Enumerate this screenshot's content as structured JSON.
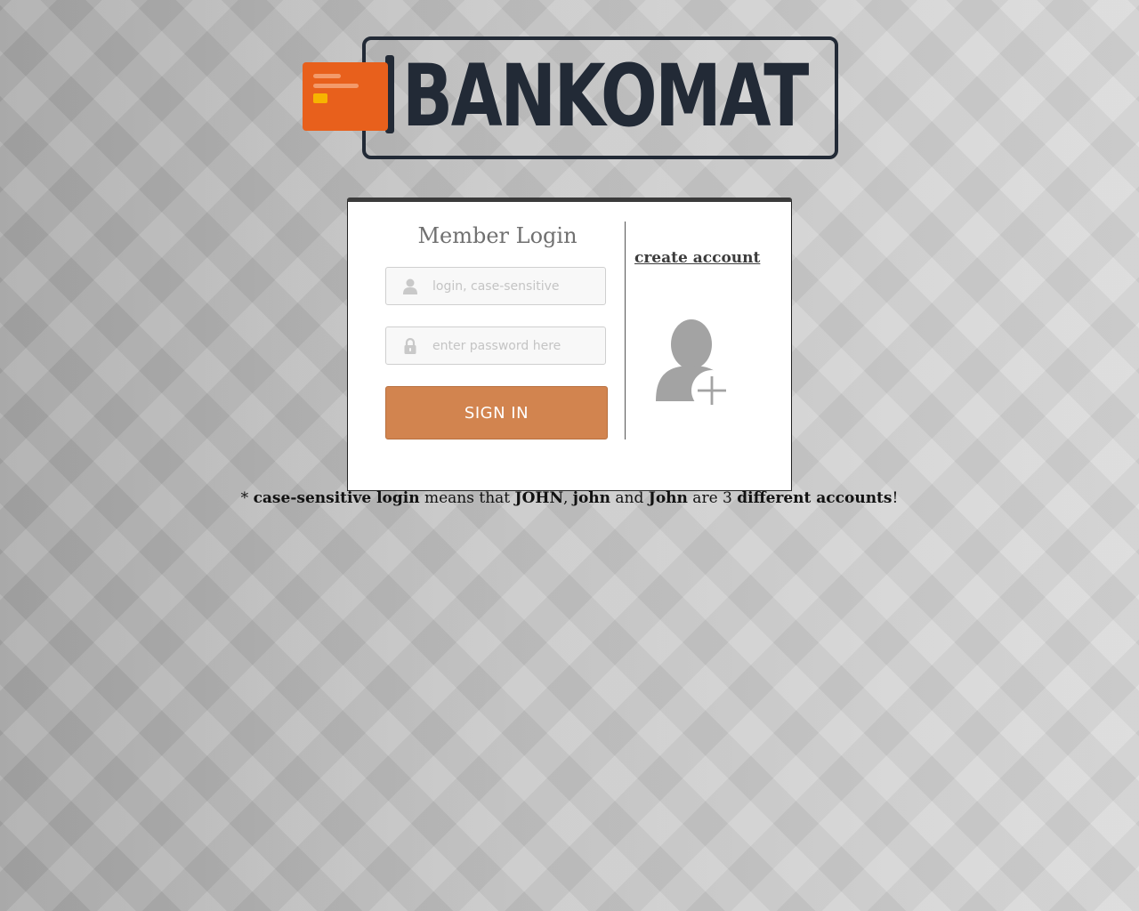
{
  "logo": {
    "text": "BANKOMAT",
    "icon": "credit-card-icon",
    "colors": {
      "card": "#e8601c",
      "chip": "#f7b400",
      "frame": "#222a36"
    }
  },
  "login": {
    "title": "Member Login",
    "username": {
      "placeholder": "login, case-sensitive",
      "value": "",
      "icon": "user-icon"
    },
    "password": {
      "placeholder": "enter password here",
      "value": "",
      "icon": "lock-icon"
    },
    "submit_label": "SIGN IN",
    "accent_color": "#d2844f"
  },
  "signup": {
    "link_label": "create account",
    "icon": "add-user-icon"
  },
  "footnote": {
    "prefix": "* ",
    "term": "case-sensitive login",
    "t1": " means that ",
    "name1": "JOHN",
    "sep1": ", ",
    "name2": "john",
    "t2": " and ",
    "name3": "John",
    "t3": " are 3 ",
    "emphasis": "different accounts",
    "suffix": "!"
  }
}
